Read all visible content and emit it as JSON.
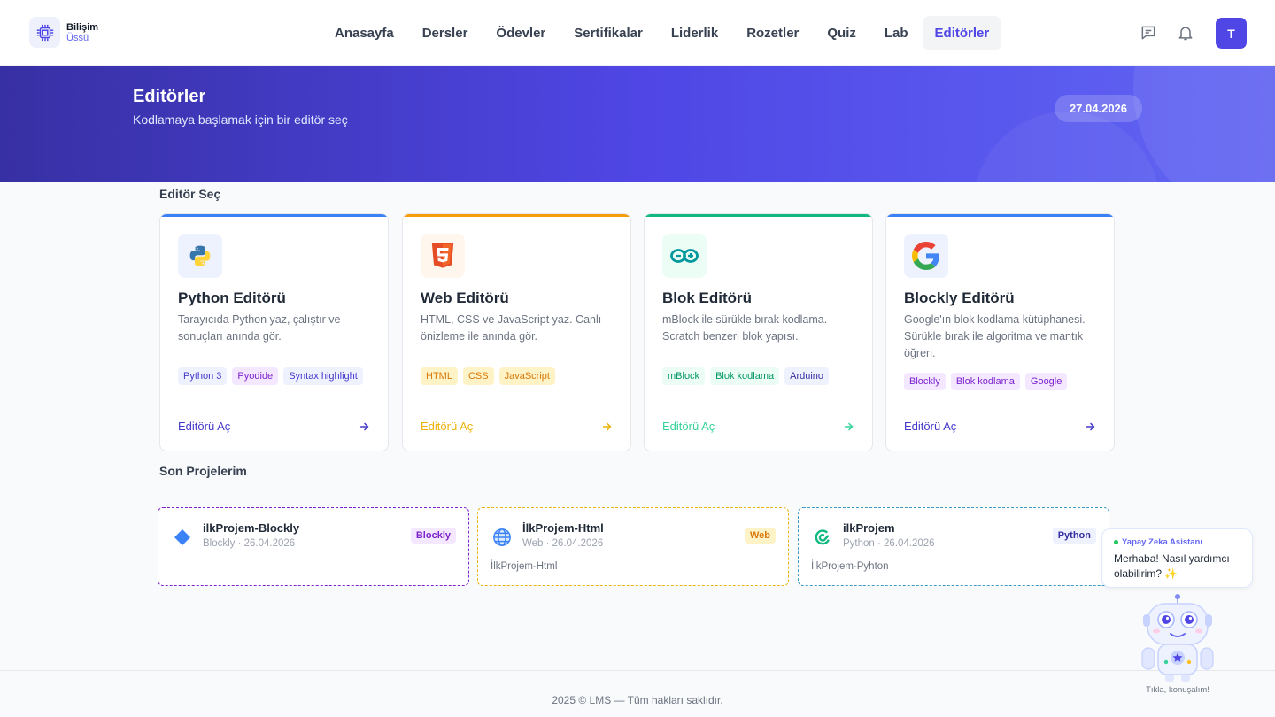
{
  "brand": {
    "title": "Bilişim",
    "subtitle": "Üssü",
    "icon": "chip-icon",
    "color": "#4f46e5"
  },
  "nav": {
    "items": [
      {
        "label": "Anasayfa",
        "active": false
      },
      {
        "label": "Dersler",
        "active": false
      },
      {
        "label": "Ödevler",
        "active": false
      },
      {
        "label": "Sertifikalar",
        "active": false
      },
      {
        "label": "Liderlik",
        "active": false
      },
      {
        "label": "Rozetler",
        "active": false
      },
      {
        "label": "Quiz",
        "active": false
      },
      {
        "label": "Lab",
        "active": false
      },
      {
        "label": "Editörler",
        "active": true
      }
    ],
    "icons": [
      "message-icon",
      "bell-icon"
    ],
    "avatar": "T"
  },
  "hero": {
    "title": "Editörler",
    "subtitle": "Kodlamaya başlamak için bir editör seç",
    "date": "27.04.2026"
  },
  "editors": {
    "section_title": "Editör Seç",
    "cards": [
      {
        "title": "Python Editörü",
        "description": "Tarayıcıda Python yaz, çalıştır ve sonuçları anında gör.",
        "icon": "python-icon",
        "accent": "#3b82f6",
        "tags": [
          {
            "label": "Python 3",
            "bg": "#eef2ff",
            "fg": "#4338ca"
          },
          {
            "label": "Pyodide",
            "bg": "#f3e8ff",
            "fg": "#7e22ce"
          },
          {
            "label": "Syntax highlight",
            "bg": "#eef2ff",
            "fg": "#4338ca"
          }
        ],
        "open_label": "Editörü Aç",
        "open_color": "#4338ca"
      },
      {
        "title": "Web Editörü",
        "description": "HTML, CSS ve JavaScript yaz. Canlı önizleme ile anında gör.",
        "icon": "html5-icon",
        "accent": "#f59e0b",
        "tags": [
          {
            "label": "HTML",
            "bg": "#fef3c7",
            "fg": "#d97706"
          },
          {
            "label": "CSS",
            "bg": "#fef3c7",
            "fg": "#d97706"
          },
          {
            "label": "JavaScript",
            "bg": "#fef3c7",
            "fg": "#d97706"
          }
        ],
        "open_label": "Editörü Aç",
        "open_color": "#eab308"
      },
      {
        "title": "Blok Editörü",
        "description": "mBlock ile sürükle bırak kodlama. Scratch benzeri blok yapısı.",
        "icon": "arduino-icon",
        "accent": "#10b981",
        "tags": [
          {
            "label": "mBlock",
            "bg": "#ecfdf5",
            "fg": "#059669"
          },
          {
            "label": "Blok kodlama",
            "bg": "#ecfdf5",
            "fg": "#059669"
          },
          {
            "label": "Arduino",
            "bg": "#eef2ff",
            "fg": "#3730a3"
          }
        ],
        "open_label": "Editörü Aç",
        "open_color": "#34d399"
      },
      {
        "title": "Blockly Editörü",
        "description": "Google'ın blok kodlama kütüphanesi. Sürükle bırak ile algoritma ve mantık öğren.",
        "icon": "google-icon",
        "accent": "#3b82f6",
        "tags": [
          {
            "label": "Blockly",
            "bg": "#f3e8ff",
            "fg": "#7e22ce"
          },
          {
            "label": "Blok kodlama",
            "bg": "#f3e8ff",
            "fg": "#7e22ce"
          },
          {
            "label": "Google",
            "bg": "#f3e8ff",
            "fg": "#7e22ce"
          }
        ],
        "open_label": "Editörü Aç",
        "open_color": "#4338ca"
      }
    ]
  },
  "projects": {
    "section_title": "Son Projelerim",
    "items": [
      {
        "name": "ilkProjem-Blockly",
        "meta": "Blockly · 26.04.2026",
        "badge": "Blockly",
        "note": "",
        "icon": "blockly-diamond-icon",
        "border": "#7e22ce",
        "badge_bg": "#f3e8ff",
        "badge_fg": "#7e22ce"
      },
      {
        "name": "İlkProjem-Html",
        "meta": "Web · 26.04.2026",
        "badge": "Web",
        "note": "İlkProjem-Html",
        "icon": "globe-icon",
        "border": "#eab308",
        "badge_bg": "#fef3c7",
        "badge_fg": "#d97706"
      },
      {
        "name": "ilkProjem",
        "meta": "Python · 26.04.2026",
        "badge": "Python",
        "note": "İlkProjem-Pyhton",
        "icon": "python-snake-icon",
        "border": "#3b9ac4",
        "badge_bg": "#eef2ff",
        "badge_fg": "#3730a3"
      }
    ]
  },
  "footer": {
    "text": "2025 © LMS — Tüm hakları saklıdır."
  },
  "assistant": {
    "name": "Yapay Zeka Asistanı",
    "message": "Merhaba! Nasıl yardımcı olabilirim? ✨",
    "caption": "Tıkla, konuşalım!",
    "icon": "robot-icon"
  }
}
